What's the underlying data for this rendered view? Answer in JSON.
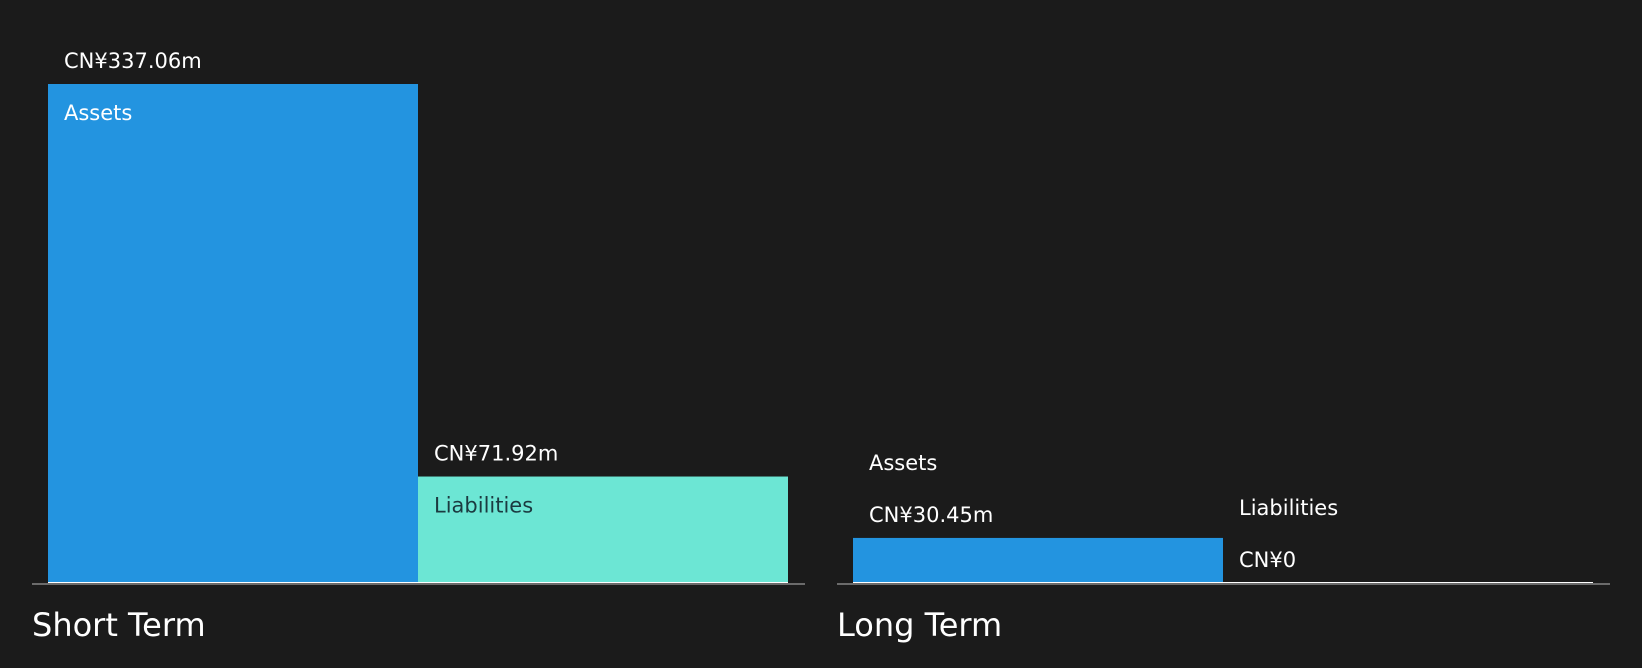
{
  "colors": {
    "background": "#1b1b1b",
    "assets": "#2394e0",
    "liabilities": "#6ce6d4",
    "baseline": "#6b6b6b",
    "zero_bar": "#ffffff",
    "text_light": "#ffffff",
    "text_dark": "#1b3a40"
  },
  "chart_data": {
    "type": "bar",
    "unit": "CN¥ millions",
    "ylim": [
      0,
      337.06
    ],
    "grid": false,
    "groups": [
      {
        "title": "Short Term",
        "bars": [
          {
            "category": "Assets",
            "value": 337.06,
            "value_label": "CN¥337.06m"
          },
          {
            "category": "Liabilities",
            "value": 71.92,
            "value_label": "CN¥71.92m"
          }
        ]
      },
      {
        "title": "Long Term",
        "bars": [
          {
            "category": "Assets",
            "value": 30.45,
            "value_label": "CN¥30.45m"
          },
          {
            "category": "Liabilities",
            "value": 0,
            "value_label": "CN¥0"
          }
        ]
      }
    ]
  }
}
